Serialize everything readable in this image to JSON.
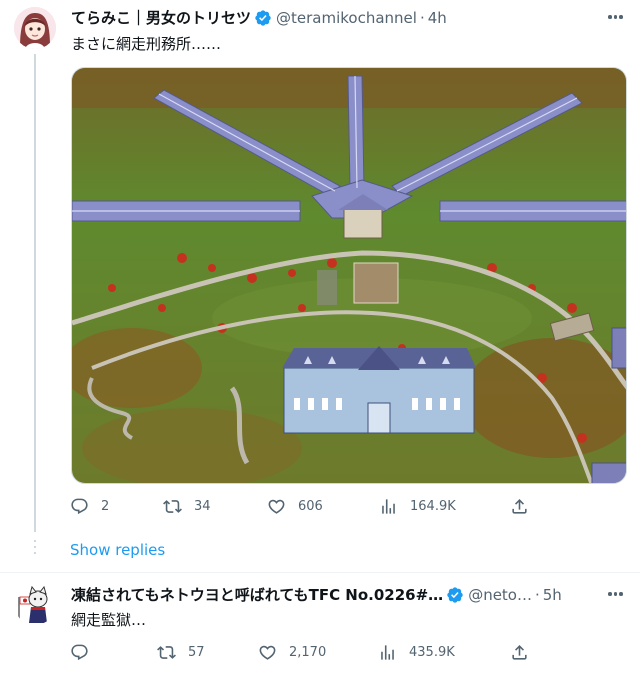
{
  "tweet1": {
    "author_name": "てらみこ｜男女のトリセツ",
    "handle": "@teramikochannel",
    "dot": "·",
    "time": "4h",
    "text": "まさに網走刑務所……",
    "actions": {
      "replies": "2",
      "retweets": "34",
      "likes": "606",
      "views": "164.9K"
    }
  },
  "show_replies": "Show replies",
  "tweet2": {
    "author_name": "凍結されてもネトウヨと呼ばれてもTFC No.0226#…",
    "handle": "@neto…",
    "dot": "·",
    "time": "5h",
    "text": "網走監獄…",
    "actions": {
      "replies": "",
      "retweets": "57",
      "likes": "2,170",
      "views": "435.9K"
    }
  },
  "colors": {
    "verified": "#1d9bf0",
    "link": "#1d9bf0",
    "secondary_text": "#536471"
  },
  "icons": [
    "more-icon",
    "verified-badge-icon",
    "reply-icon",
    "retweet-icon",
    "like-icon",
    "views-icon",
    "share-icon"
  ]
}
